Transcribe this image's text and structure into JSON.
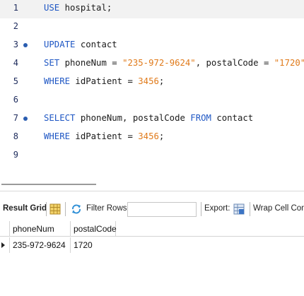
{
  "editor": {
    "lines": [
      {
        "n": "1",
        "tokens": [
          [
            "kw",
            "USE"
          ],
          [
            "t",
            " hospital;"
          ]
        ]
      },
      {
        "n": "2",
        "tokens": []
      },
      {
        "n": "3",
        "tokens": [
          [
            "kw",
            "UPDATE"
          ],
          [
            "t",
            " contact"
          ]
        ]
      },
      {
        "n": "4",
        "tokens": [
          [
            "kw",
            "SET"
          ],
          [
            "t",
            " phoneNum = "
          ],
          [
            "str",
            "\"235-972-9624\""
          ],
          [
            "t",
            ", postalCode = "
          ],
          [
            "str",
            "\"1720\""
          ]
        ]
      },
      {
        "n": "5",
        "tokens": [
          [
            "kw",
            "WHERE"
          ],
          [
            "t",
            " idPatient = "
          ],
          [
            "num",
            "3456"
          ],
          [
            "t",
            ";"
          ]
        ]
      },
      {
        "n": "6",
        "tokens": []
      },
      {
        "n": "7",
        "tokens": [
          [
            "kw",
            "SELECT"
          ],
          [
            "t",
            " phoneNum, postalCode "
          ],
          [
            "kw",
            "FROM"
          ],
          [
            "t",
            " contact"
          ]
        ]
      },
      {
        "n": "8",
        "tokens": [
          [
            "kw",
            "WHERE"
          ],
          [
            "t",
            " idPatient = "
          ],
          [
            "num",
            "3456"
          ],
          [
            "t",
            ";"
          ]
        ]
      },
      {
        "n": "9",
        "tokens": []
      }
    ]
  },
  "toolbar": {
    "result_grid_label": "Result Grid",
    "filter_rows_label": "Filter Rows:",
    "filter_value": "",
    "export_label": "Export:",
    "wrap_label": "Wrap Cell Cont"
  },
  "grid": {
    "columns": [
      "phoneNum",
      "postalCode"
    ],
    "rows": [
      [
        "235-972-9624",
        "1720"
      ]
    ]
  },
  "colors": {
    "keyword": "#1f57c4",
    "literal": "#e07a1a",
    "line_number": "#1d2b5c",
    "marker": "#2a5db0"
  }
}
